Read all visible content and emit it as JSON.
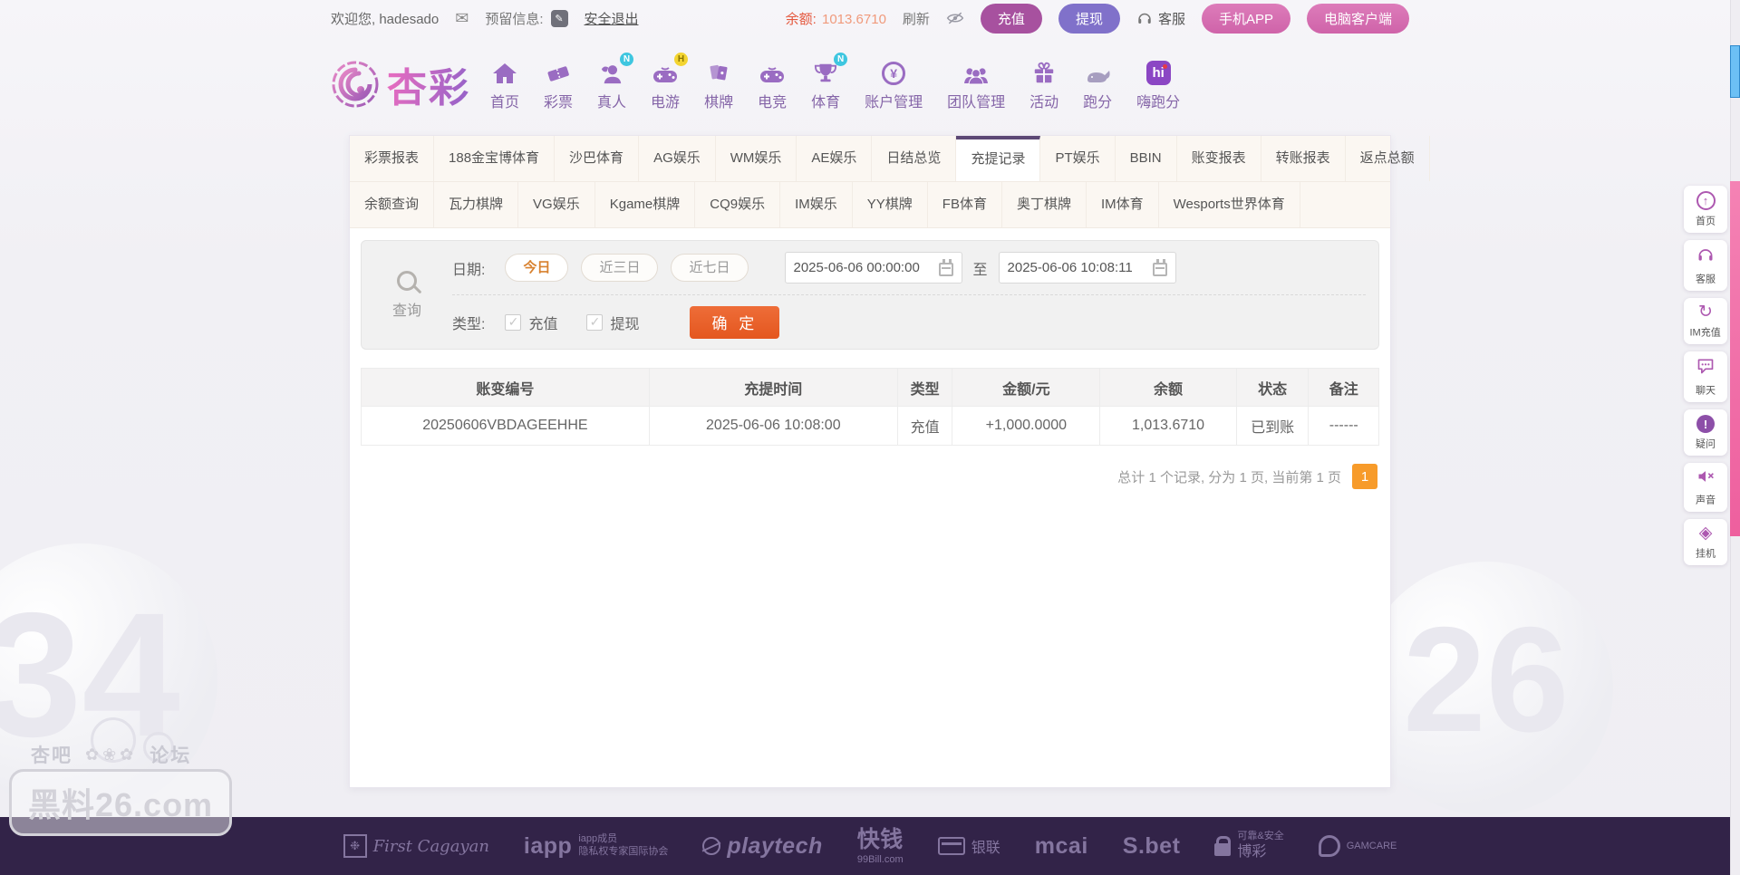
{
  "topbar": {
    "welcome": "欢迎您, hadesado",
    "reserved_label": "预留信息:",
    "logout": "安全退出",
    "balance_label": "余额:",
    "balance_value": "1013.6710",
    "refresh_label": "刷新",
    "deposit_button": "充值",
    "withdraw_button": "提现",
    "service_label": "客服",
    "mobile_app_button": "手机APP",
    "pc_client_button": "电脑客户端"
  },
  "brand": {
    "name": "杏彩"
  },
  "nav": {
    "items": [
      {
        "label": "首页"
      },
      {
        "label": "彩票"
      },
      {
        "label": "真人",
        "badge": "N"
      },
      {
        "label": "电游",
        "badge": "H"
      },
      {
        "label": "棋牌"
      },
      {
        "label": "电竞"
      },
      {
        "label": "体育",
        "badge": "N"
      },
      {
        "label": "账户管理"
      },
      {
        "label": "团队管理"
      },
      {
        "label": "活动"
      },
      {
        "label": "跑分"
      },
      {
        "label": "嗨跑分"
      }
    ]
  },
  "tabs": {
    "row1": [
      "彩票报表",
      "188金宝博体育",
      "沙巴体育",
      "AG娱乐",
      "WM娱乐",
      "AE娱乐",
      "日结总览",
      "充提记录",
      "PT娱乐",
      "BBIN",
      "账变报表",
      "转账报表",
      "返点总额"
    ],
    "row2": [
      "余额查询",
      "瓦力棋牌",
      "VG娱乐",
      "Kgame棋牌",
      "CQ9娱乐",
      "IM娱乐",
      "YY棋牌",
      "FB体育",
      "奥丁棋牌",
      "IM体育",
      "Wesports世界体育"
    ],
    "active_tab": "充提记录"
  },
  "query": {
    "panel_label": "查询",
    "date_label": "日期:",
    "quick_ranges": [
      "今日",
      "近三日",
      "近七日"
    ],
    "active_range": "今日",
    "date_from": "2025-06-06 00:00:00",
    "to_label": "至",
    "date_to": "2025-06-06 10:08:11",
    "type_label": "类型:",
    "type_options": [
      "充值",
      "提现"
    ],
    "submit_button": "确 定"
  },
  "table": {
    "headers": [
      "账变编号",
      "充提时间",
      "类型",
      "金额/元",
      "余额",
      "状态",
      "备注"
    ],
    "rows": [
      {
        "cells": [
          "20250606VBDAGEEHHE",
          "2025-06-06 10:08:00",
          "充值",
          "+1,000.0000",
          "1,013.6710",
          "已到账",
          "------"
        ]
      }
    ]
  },
  "pagination": {
    "summary": "总计 1 个记录, 分为 1 页, 当前第 1 页",
    "current_page": "1"
  },
  "float_menu": {
    "items": [
      {
        "label": "首页"
      },
      {
        "label": "客服"
      },
      {
        "label": "IM充值"
      },
      {
        "label": "聊天"
      },
      {
        "label": "疑问"
      },
      {
        "label": "声音"
      },
      {
        "label": "挂机"
      }
    ]
  },
  "footer": {
    "logos": [
      {
        "name": "first-cagayan",
        "text": "First Cagayan"
      },
      {
        "name": "iapp",
        "text": "iapp",
        "line1": "iapp成员",
        "line2": "隐私权专家国际协会"
      },
      {
        "name": "playtech",
        "text": "playtech"
      },
      {
        "name": "99bill",
        "text": "快钱",
        "line1": "99Bill.com"
      },
      {
        "name": "unionpay",
        "text": "银联"
      },
      {
        "name": "mcai",
        "text": "mcai"
      },
      {
        "name": "sbet",
        "text": "S.bet"
      },
      {
        "name": "bocai",
        "text": "博彩",
        "line1": "可靠&安全"
      },
      {
        "name": "gamcare",
        "text": "GAMCARE"
      }
    ]
  },
  "watermark": {
    "left": "杏吧",
    "right": "论坛",
    "site": "黑料26.com",
    "bg_left": "34",
    "bg_right": "26"
  },
  "colors": {
    "deposit_btn": "#a7519f",
    "withdraw_btn": "#8071ca",
    "pink_btn": "#d56fb0",
    "submit_orange": "#e7602b",
    "balance_orange": "#e4573d",
    "amount_red": "#cc2a26",
    "status_green": "#3caf50",
    "page_btn_orange": "#f79b2a",
    "tab_active_border": "#5c4875",
    "footer_bg": "#322348",
    "accent_purple": "#9a6cc2"
  }
}
